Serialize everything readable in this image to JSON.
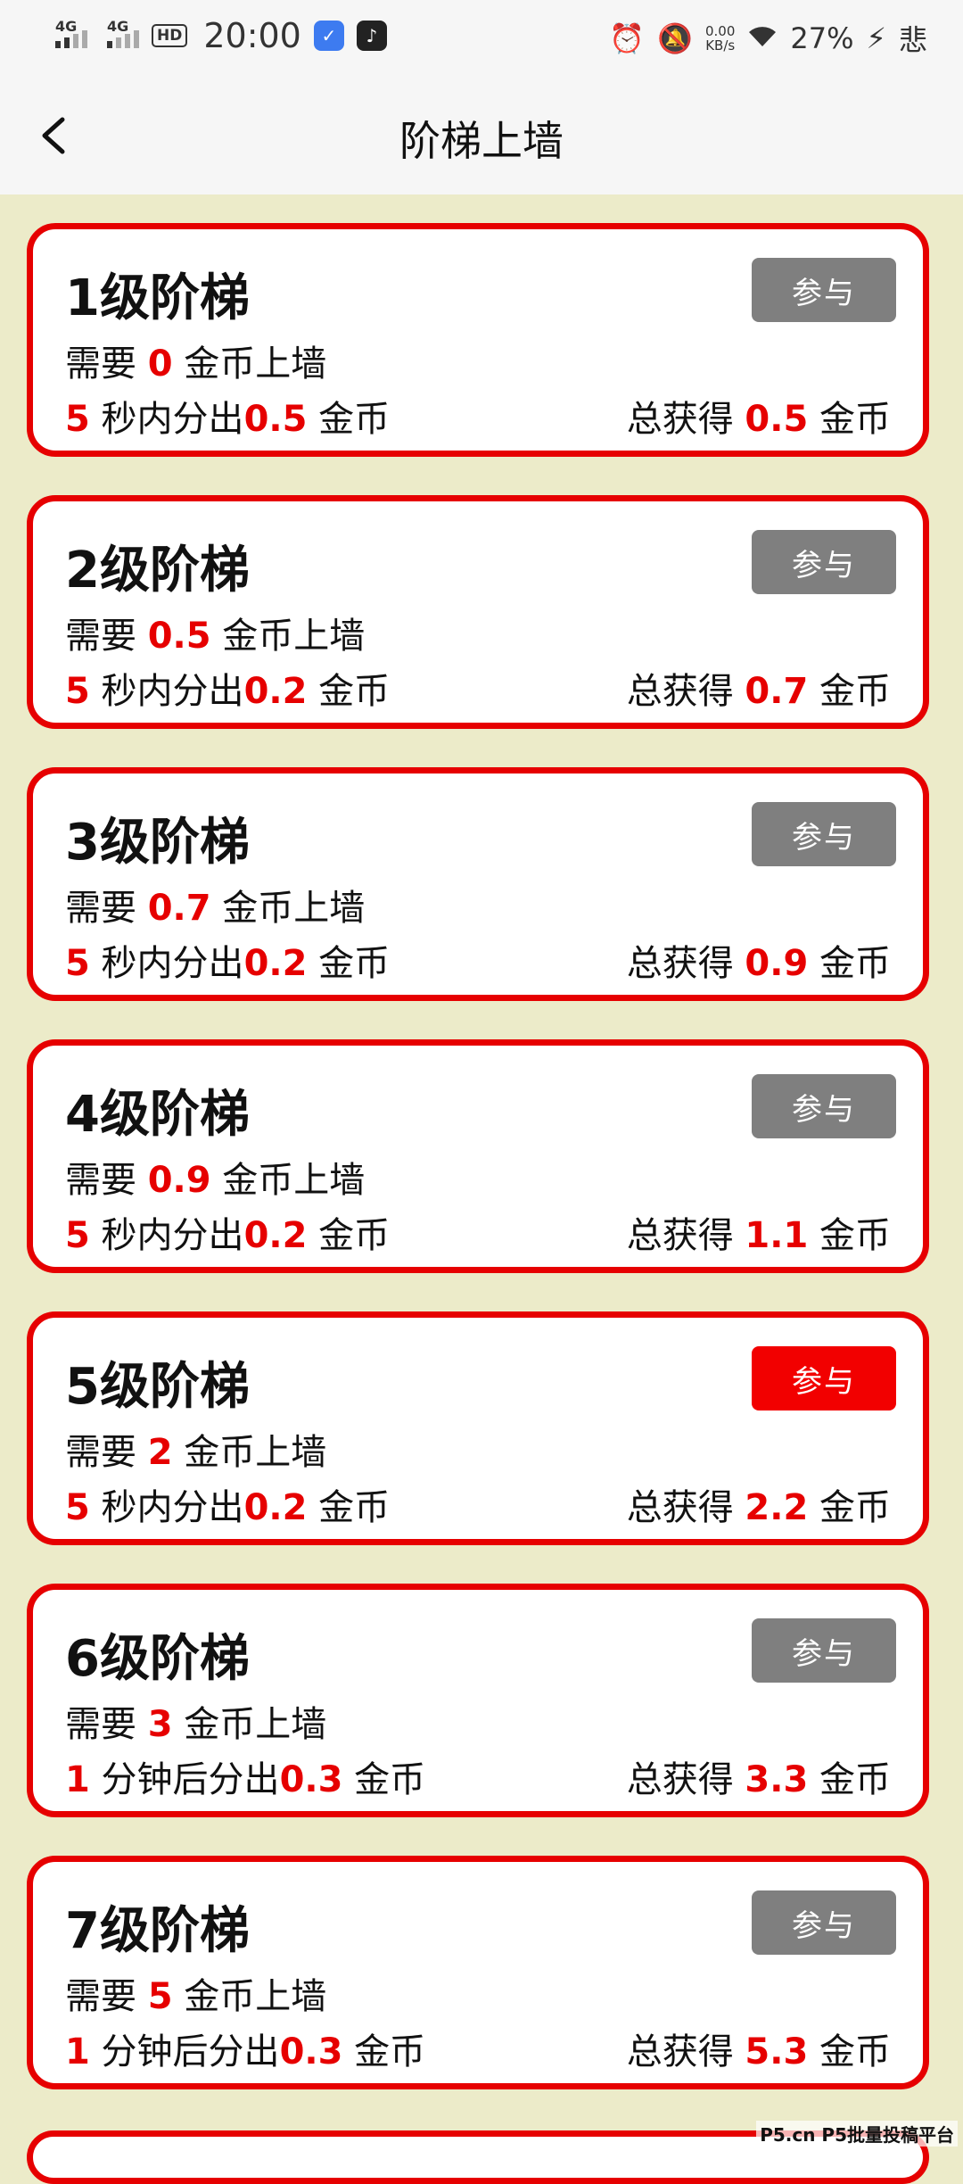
{
  "status_bar": {
    "sig1_label": "4G",
    "sig2_label": "4G",
    "hd_label": "HD",
    "time": "20:00",
    "net_speed_value": "0.00",
    "net_speed_unit": "KB/s",
    "battery": "27%",
    "carrier": "悲"
  },
  "header": {
    "title": "阶梯上墙"
  },
  "cards": [
    {
      "level": "1级阶梯",
      "button": "参与",
      "active": false,
      "req_prefix": "需要 ",
      "req_value": "0",
      "req_suffix": " 金币上墙",
      "time_value": "5",
      "time_text": " 秒内分出",
      "payout": "0.5",
      "payout_unit": " 金币",
      "total_prefix": "总获得 ",
      "total_value": "0.5",
      "total_unit": " 金币"
    },
    {
      "level": "2级阶梯",
      "button": "参与",
      "active": false,
      "req_prefix": "需要 ",
      "req_value": "0.5",
      "req_suffix": " 金币上墙",
      "time_value": "5",
      "time_text": " 秒内分出",
      "payout": "0.2",
      "payout_unit": " 金币",
      "total_prefix": "总获得 ",
      "total_value": "0.7",
      "total_unit": " 金币"
    },
    {
      "level": "3级阶梯",
      "button": "参与",
      "active": false,
      "req_prefix": "需要 ",
      "req_value": "0.7",
      "req_suffix": " 金币上墙",
      "time_value": "5",
      "time_text": " 秒内分出",
      "payout": "0.2",
      "payout_unit": " 金币",
      "total_prefix": "总获得 ",
      "total_value": "0.9",
      "total_unit": " 金币"
    },
    {
      "level": "4级阶梯",
      "button": "参与",
      "active": false,
      "req_prefix": "需要 ",
      "req_value": "0.9",
      "req_suffix": " 金币上墙",
      "time_value": "5",
      "time_text": " 秒内分出",
      "payout": "0.2",
      "payout_unit": " 金币",
      "total_prefix": "总获得 ",
      "total_value": "1.1",
      "total_unit": " 金币"
    },
    {
      "level": "5级阶梯",
      "button": "参与",
      "active": true,
      "req_prefix": "需要 ",
      "req_value": "2",
      "req_suffix": " 金币上墙",
      "time_value": "5",
      "time_text": " 秒内分出",
      "payout": "0.2",
      "payout_unit": " 金币",
      "total_prefix": "总获得 ",
      "total_value": "2.2",
      "total_unit": " 金币"
    },
    {
      "level": "6级阶梯",
      "button": "参与",
      "active": false,
      "req_prefix": "需要 ",
      "req_value": "3",
      "req_suffix": " 金币上墙",
      "time_value": "1",
      "time_text": " 分钟后分出",
      "payout": "0.3",
      "payout_unit": " 金币",
      "total_prefix": "总获得 ",
      "total_value": "3.3",
      "total_unit": " 金币"
    },
    {
      "level": "7级阶梯",
      "button": "参与",
      "active": false,
      "req_prefix": "需要 ",
      "req_value": "5",
      "req_suffix": " 金币上墙",
      "time_value": "1",
      "time_text": " 分钟后分出",
      "payout": "0.3",
      "payout_unit": " 金币",
      "total_prefix": "总获得 ",
      "total_value": "5.3",
      "total_unit": " 金币"
    }
  ],
  "watermark": "P5.cn P5批量投稿平台",
  "colors": {
    "accent_red": "#e60000",
    "button_gray": "#7f7f7f",
    "background": "#ecebc9"
  }
}
